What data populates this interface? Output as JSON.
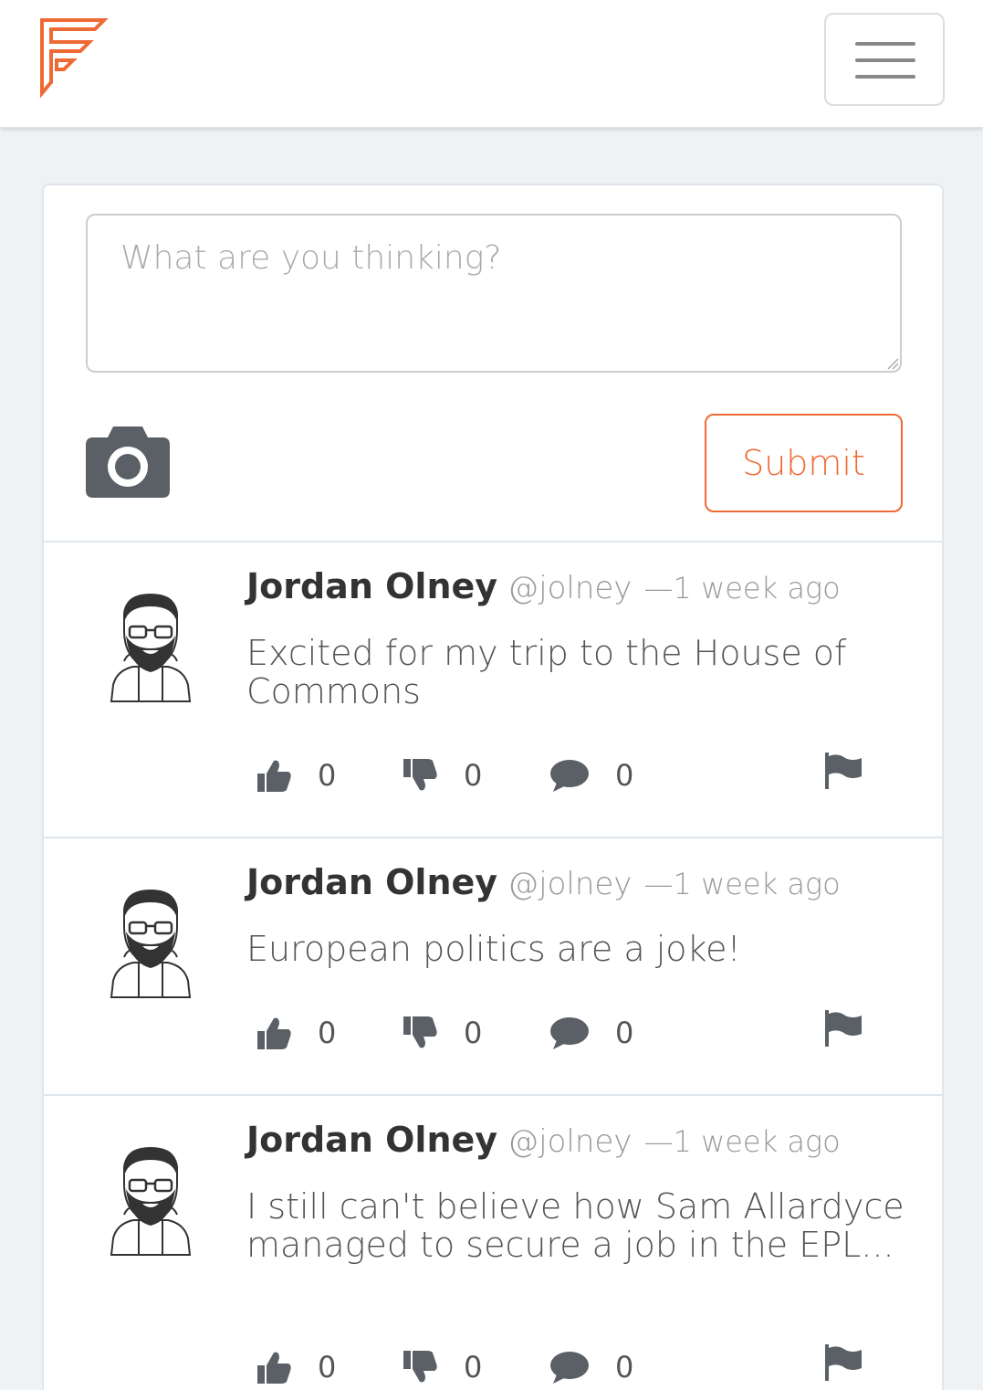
{
  "brand": {
    "accent": "#ee6a35",
    "logo": "F-logo"
  },
  "navbar": {
    "menu_icon": "hamburger-icon"
  },
  "composer": {
    "placeholder": "What are you thinking?",
    "camera_icon": "camera-icon",
    "submit_label": "Submit"
  },
  "posts": [
    {
      "author": "Jordan Olney",
      "handle": "@jolney",
      "time": "—1 week ago",
      "text": "Excited for my trip to the House of Commons",
      "likes": "0",
      "dislikes": "0",
      "comments": "0"
    },
    {
      "author": "Jordan Olney",
      "handle": "@jolney",
      "time": "—1 week ago",
      "text": "European politics are a joke!",
      "likes": "0",
      "dislikes": "0",
      "comments": "0"
    },
    {
      "author": "Jordan Olney",
      "handle": "@jolney",
      "time": "—1 week ago",
      "text": "I still can't believe how Sam Allardyce managed to secure a job in the EPL...",
      "likes": "0",
      "dislikes": "0",
      "comments": "0"
    }
  ]
}
